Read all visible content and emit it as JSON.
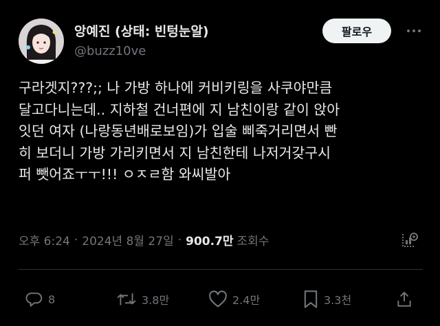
{
  "author": {
    "display_name": "앙예진 (상태: 빈텅눈알)",
    "handle": "@buzz10ve"
  },
  "header": {
    "follow_label": "팔로우",
    "more_icon": "more-horizontal-icon"
  },
  "tweet": {
    "lines": [
      "구라겟지???;; 나 가방 하나에 커비키링을 사쿠야만큼",
      "달고다니는데.. 지하철 건너편에 지 남친이랑 같이 앉아",
      "잇던 여자 (나랑동년배로보임)가 입술 삐죽거리면서 빤",
      "히 보더니 가방 가리키면서  지 남친한테 나저거갖구시",
      "퍼 뺏어죠ㅜㅜ!!! ㅇㅈㄹ함 와씨발아"
    ]
  },
  "meta": {
    "time": "오후 6:24",
    "separator": "·",
    "date": "2024년 8월 27일",
    "views_count": "900.7만",
    "views_label": "조회수"
  },
  "actions": {
    "replies": "8",
    "reposts": "3.8만",
    "likes": "2.4만",
    "bookmarks": "3.3천"
  },
  "colors": {
    "background": "#000000",
    "text_primary": "#e7e9ea",
    "text_secondary": "#71767b",
    "divider": "#2f3336",
    "follow_button_bg": "#eff3f4"
  }
}
